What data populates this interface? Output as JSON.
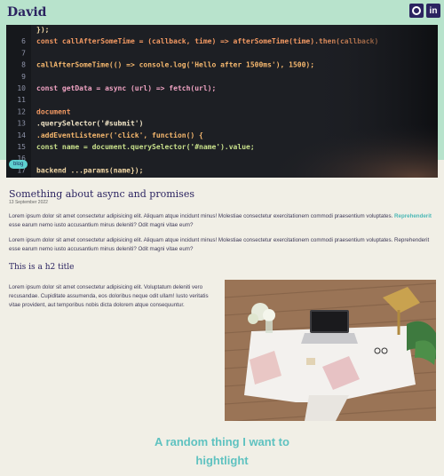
{
  "site": {
    "title": "David",
    "social": {
      "github_icon": "github-icon",
      "linkedin_icon": "linkedin-icon",
      "linkedin_text": "in"
    }
  },
  "hero": {
    "code_lines": [
      {
        "num": "",
        "text": "});"
      },
      {
        "num": "6",
        "text": "const callAfterSomeTime = (callback, time) => afterSomeTime(time).then(callback)"
      },
      {
        "num": "7",
        "text": ""
      },
      {
        "num": "8",
        "text": "callAfterSomeTime(() => console.log('Hello after 1500ms'), 1500);"
      },
      {
        "num": "9",
        "text": ""
      },
      {
        "num": "10",
        "text": "const getData = async (url) => fetch(url);"
      },
      {
        "num": "11",
        "text": ""
      },
      {
        "num": "12",
        "text": "document"
      },
      {
        "num": "13",
        "text": "  .querySelector('#submit')"
      },
      {
        "num": "14",
        "text": "  .addEventListener('click', function() {"
      },
      {
        "num": "15",
        "text": "    const name = document.querySelector('#name').value;"
      },
      {
        "num": "16",
        "text": ""
      },
      {
        "num": "17",
        "text": "    backend      ...params(name});"
      }
    ]
  },
  "post": {
    "tag": "blog",
    "title": "Something about async and promises",
    "date": "13 September 2022",
    "para1_a": "Lorem ipsum dolor sit amet consectetur adipisicing elit. Aliquam atque incidunt minus! Molestiae consectetur exercitationem commodi praesentium voluptates.",
    "para1_link": "Reprehenderit",
    "para1_b": " esse earum nemo iusto accusantium minus deleniti? Odit magni vitae eum?",
    "para2": "Lorem ipsum dolor sit amet consectetur adipisicing elit. Aliquam atque incidunt minus! Molestiae consectetur exercitationem commodi praesentium voluptates. Reprehenderit esse earum nemo iusto accusantium minus deleniti? Odit magni vitae eum?",
    "h2": "This is a h2 title",
    "para3": "Lorem ipsum dolor sit amet consectetur adipisicing elit. Voluptatum deleniti vero recusandae. Cupiditate assumenda, eos doloribus neque odit ullam! Iusto veritatis vitae provident, aut temporibus nobis dicta dolorem atque consequuntur.",
    "highlight": "A random thing I want to hightlight"
  },
  "colors": {
    "header_band": "#b8e3cc",
    "background": "#f1efe6",
    "primary": "#2b2360",
    "accent": "#5fc2c0"
  }
}
